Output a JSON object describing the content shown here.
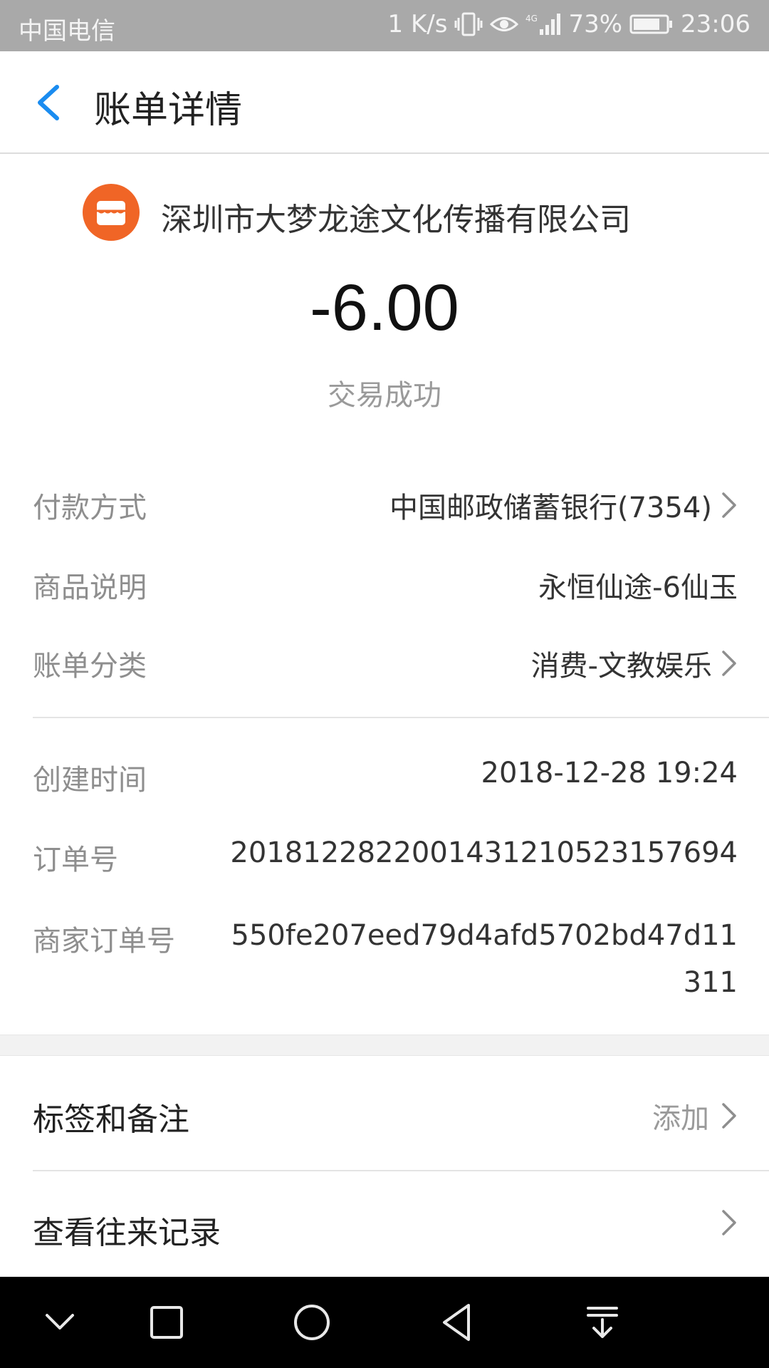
{
  "status_bar": {
    "carrier": "中国电信",
    "speed": "1 K/s",
    "network": "4G",
    "battery": "73%",
    "time": "23:06"
  },
  "header": {
    "back_icon": "chevron-left-icon",
    "title": "账单详情"
  },
  "merchant": {
    "logo_icon": "shop-icon",
    "logo_color": "#f06526",
    "name": "深圳市大梦龙途文化传播有限公司"
  },
  "amount": "-6.00",
  "transaction_status": "交易成功",
  "details": {
    "payment_method": {
      "label": "付款方式",
      "value": "中国邮政储蓄银行(7354)"
    },
    "product": {
      "label": "商品说明",
      "value": "永恒仙途-6仙玉"
    },
    "category": {
      "label": "账单分类",
      "value": "消费-文教娱乐"
    },
    "created_time": {
      "label": "创建时间",
      "value": "2018-12-28 19:24"
    },
    "order_no": {
      "label": "订单号",
      "value": "20181228220014312105231576​94"
    },
    "merchant_order_no": {
      "label": "商家订单号",
      "value": "550fe207eed79d4afd5702bd47d11311"
    }
  },
  "actions": {
    "tags_notes": {
      "label": "标签和备注",
      "action": "添加"
    },
    "history": {
      "label": "查看往来记录"
    }
  },
  "accent_color": "#1a8cf0"
}
